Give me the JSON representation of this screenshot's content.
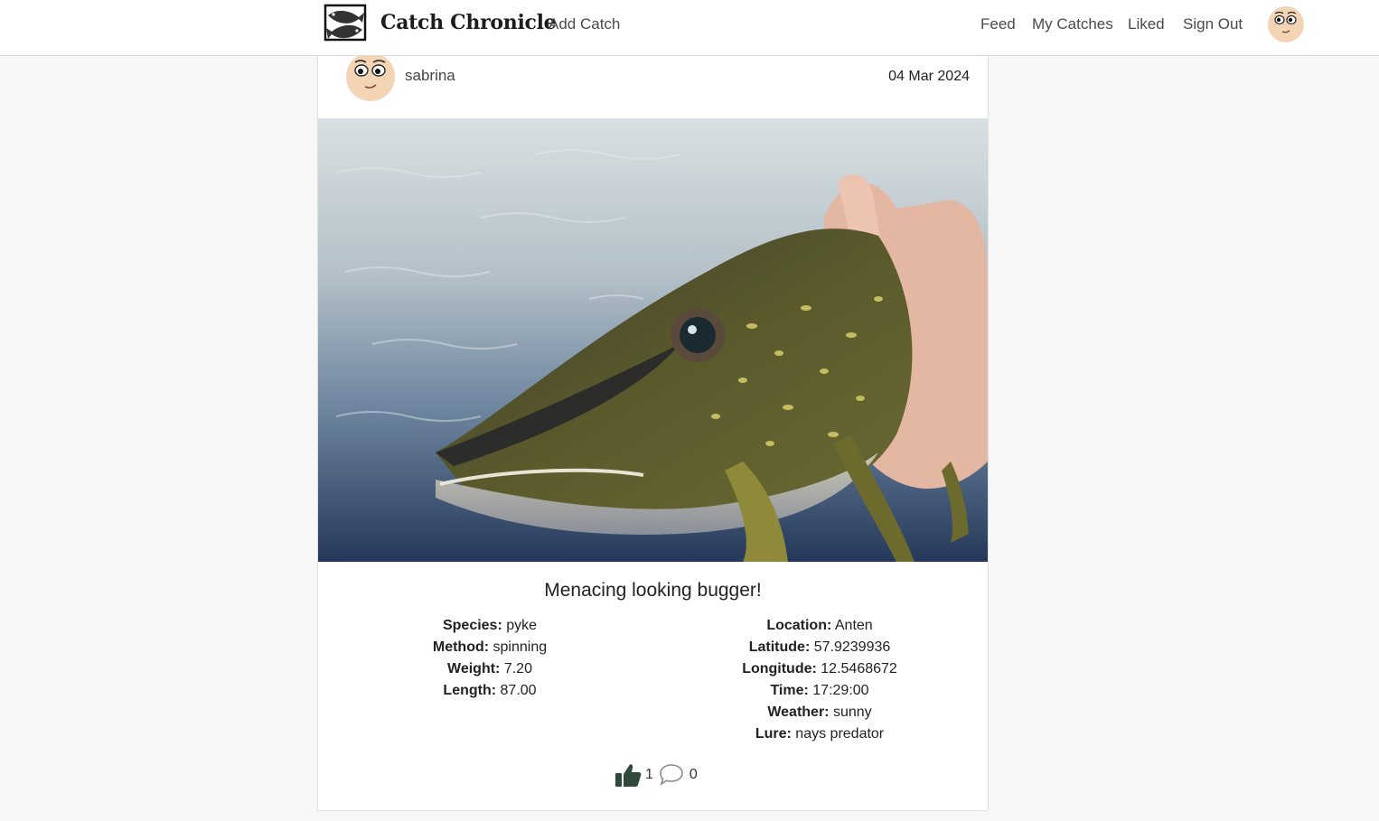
{
  "app": {
    "title": "Catch Chronicle",
    "logo_icon": "fish-logo-icon"
  },
  "nav": {
    "add_catch": "Add Catch",
    "feed": "Feed",
    "my_catches": "My Catches",
    "liked": "Liked",
    "sign_out": "Sign Out",
    "avatar_icon": "user-avatar-icon"
  },
  "post": {
    "author": "sabrina",
    "date": "04 Mar 2024",
    "image_icon": "pike-photo",
    "caption": "Menacing looking bugger!",
    "details_left": [
      {
        "label": "Species:",
        "value": "pyke"
      },
      {
        "label": "Method:",
        "value": "spinning"
      },
      {
        "label": "Weight:",
        "value": "7.20"
      },
      {
        "label": "Length:",
        "value": "87.00"
      }
    ],
    "details_right": [
      {
        "label": "Location:",
        "value": "Anten"
      },
      {
        "label": "Latitude:",
        "value": "57.9239936"
      },
      {
        "label": "Longitude:",
        "value": "12.5468672"
      },
      {
        "label": "Time:",
        "value": "17:29:00"
      },
      {
        "label": "Weather:",
        "value": "sunny"
      },
      {
        "label": "Lure:",
        "value": "nays predator"
      }
    ],
    "likes": "1",
    "comments": "0",
    "like_icon": "thumbs-up-icon",
    "comment_icon": "comment-bubble-icon"
  },
  "colors": {
    "like_icon": "#2f4a3a",
    "nav_text": "#4a4a4a",
    "background": "#f7f7f7"
  }
}
